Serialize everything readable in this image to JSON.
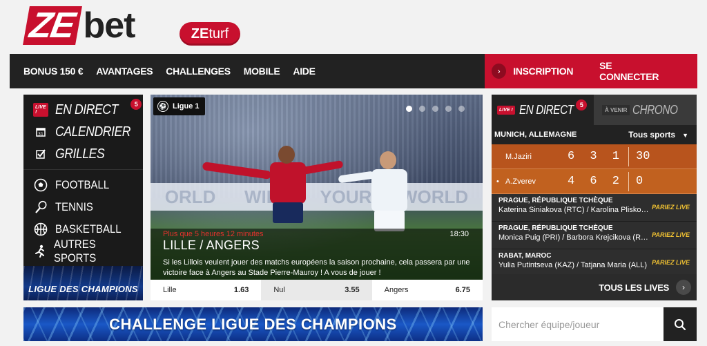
{
  "logo": {
    "ze": "ZE",
    "bet": "bet"
  },
  "partner": {
    "ze": "ZE",
    "turf": "turf"
  },
  "nav": {
    "items": [
      "BONUS 150 €",
      "AVANTAGES",
      "CHALLENGES",
      "MOBILE",
      "AIDE"
    ],
    "register": "INSCRIPTION",
    "login": "SE CONNECTER"
  },
  "sidebar": {
    "live_badge": "LIVE !",
    "live_label": "EN DIRECT",
    "live_count": "5",
    "calendar_label": "CALENDRIER",
    "grids_label": "GRILLES",
    "sports": [
      "FOOTBALL",
      "TENNIS",
      "BASKETBALL",
      "AUTRES SPORTS"
    ],
    "banner": "LIGUE DES CHAMPIONS"
  },
  "hero": {
    "league": "Ligue 1",
    "boards": [
      "ORLD",
      "WIDE",
      "YOUR",
      "WORLD"
    ],
    "countdown": "Plus que 5 heures 12 minutes",
    "time": "18:30",
    "title": "LILLE / ANGERS",
    "description": "Si les Lillois veulent jouer des matchs européens la saison prochaine, cela passera par une victoire face à Angers au Stade Pierre-Mauroy ! A vous de jouer !",
    "odds": [
      {
        "label": "Lille",
        "value": "1.63"
      },
      {
        "label": "Nul",
        "value": "3.55"
      },
      {
        "label": "Angers",
        "value": "6.75"
      }
    ],
    "slides": 5,
    "active_slide": 1
  },
  "live": {
    "badge": "LIVE !",
    "tab_live": "EN DIRECT",
    "count": "5",
    "upcoming_badge": "À VENIR",
    "tab_chrono": "CHRONO",
    "location": "MUNICH, ALLEMAGNE",
    "sport_select": "Tous sports",
    "players": [
      {
        "name": "M.Jaziri",
        "sets": "6 3 1",
        "game": "30",
        "serving": false
      },
      {
        "name": "A.Zverev",
        "sets": "4 6 2",
        "game": "0",
        "serving": true
      }
    ],
    "matches": [
      {
        "city": "PRAGUE, RÉPUBLIQUE TCHÈQUE",
        "names": "Katerina Siniakova (RTC) / Karolina Pliskova (RTC)",
        "bet": "PARIEZ LIVE"
      },
      {
        "city": "PRAGUE, RÉPUBLIQUE TCHÈQUE",
        "names": "Monica Puig (PRI) / Barbora Krejcikova (RTC)",
        "bet": "PARIEZ LIVE"
      },
      {
        "city": "RABAT, MAROC",
        "names": "Yulia Putintseva (KAZ) / Tatjana Maria (ALL)",
        "bet": "PARIEZ LIVE"
      }
    ],
    "all": "TOUS LES LIVES"
  },
  "banner": {
    "label": "CHALLENGE LIGUE DES CHAMPIONS"
  },
  "search": {
    "placeholder": "Chercher équipe/joueur"
  },
  "colors": {
    "brand_red": "#c8102e",
    "live_orange": "#b8541d",
    "bet_yellow": "#f1c232"
  }
}
